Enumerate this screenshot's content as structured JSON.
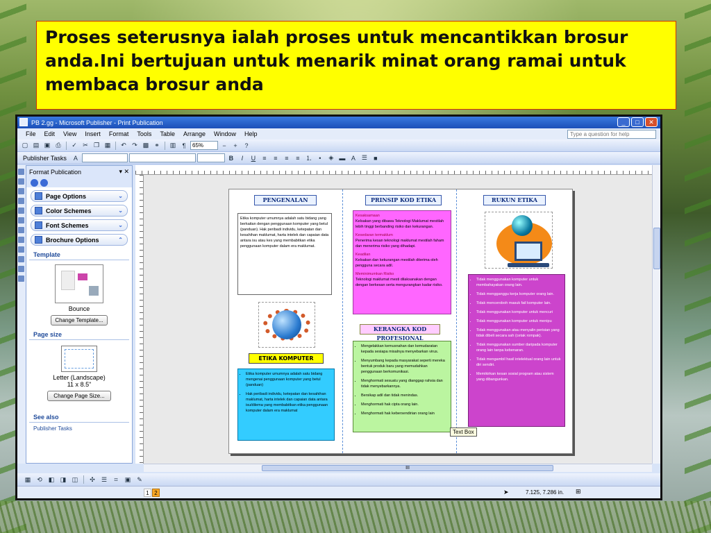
{
  "caption": {
    "text": "Proses seterusnya ialah proses untuk mencantikkan brosur anda.Ini bertujuan untuk menarik minat orang ramai untuk membaca brosur anda"
  },
  "window": {
    "title": "PB 2.gg - Microsoft Publisher - Print Publication",
    "buttons": {
      "minimize": "_",
      "maximize": "□",
      "close": "✕"
    }
  },
  "menu": {
    "items": [
      "File",
      "Edit",
      "View",
      "Insert",
      "Format",
      "Tools",
      "Table",
      "Arrange",
      "Window",
      "Help"
    ],
    "help_placeholder": "Type a question for help"
  },
  "toolbar": {
    "zoom": "65%",
    "publisher_tasks": "Publisher Tasks"
  },
  "taskpane": {
    "title": "Format Publication",
    "options": [
      "Page Options",
      "Color Schemes",
      "Font Schemes",
      "Brochure Options"
    ],
    "template_heading": "Template",
    "template_name": "Bounce",
    "change_template": "Change Template...",
    "page_size_heading": "Page size",
    "page_size_name": "Letter (Landscape)",
    "page_size_dims": "11 x 8.5\"",
    "change_page_size": "Change Page Size...",
    "see_also_heading": "See also",
    "see_also_link": "Publisher Tasks"
  },
  "brochure": {
    "panel1": {
      "title": "PENGENALAN",
      "intro": "Etika komputer umumnya adalah satu bidang yang berkaitan dengan penggunaan komputer yang betul (panduan). Hak peribadi individu, ketepatan dan kesahihan maklumat, harta intelek dan capaian data antara isu atau kes yang membabitkan etika penggunaan komputer dalam era maklumat.",
      "title2": "ETIKA KOMPUTER",
      "bullets": [
        "Etika komputer umumnya adalah satu bidang mengenai penggunaan komputer yang betul (panduan)",
        "Hak peribadi individu, ketepatan dan kesahihan maklumat, harta intelek dan capaian data antara isu/dilema yang membabitkan etika penggunaan komputer dalam era maklumat"
      ]
    },
    "panel2": {
      "title": "PRINSIP KOD ETIKA",
      "sections": [
        {
          "heading": "Kesaksamaan",
          "text": "Kelsakan yang dibawa Teknologi Maklumat mestilah lebih tinggi berbanding risiko dan kekurangan."
        },
        {
          "heading": "Kesedaran termaklum",
          "text": "Penerima kesan teknologi maklumat mestilah faham dan menerima risiko yang dihadapi."
        },
        {
          "heading": "Keadilan",
          "text": "Kelsakan dan kekurangan mestilah diterima oleh pengguna secara adil."
        },
        {
          "heading": "Meminimumkan Risiko",
          "text": "Teknologi maklumat mesti dilaksanakan dengan dengan berkesan serta mengurangkan kadar risiko."
        }
      ],
      "title2": "KERANGKA KOD PROFESIONAL",
      "bullets": [
        "Mengelakkan kemusnahan dan kemudaratan kepada sesiapa misalnya menyebarkan virus.",
        "Menyumbang kepada masyarakat seperti mereka bentuk produk baru yang memudahkan penggunaan berkomunikasi.",
        "Menghormati sesuatu yang dianggap rahsia dan tidak menyebarkannya.",
        "Bersikap adil dan tidak menindas.",
        "Menghormati hak cipta orang lain.",
        "Menghormati hak kebersendirian orang lain"
      ]
    },
    "panel3": {
      "title": "RUKUN ETIKA",
      "bullets": [
        "Tidak menggunakan komputer untuk membahayakan orang lain.",
        "Tidak mengganggu kerja komputer orang lain.",
        "Tidak menceroboh masuk fail komputer lain.",
        "Tidak menggunakan komputer untuk mencuri",
        "Tidak menggunakan komputer untuk menipu",
        "Tidak menggunakan atau menyalin perisian yang tidak dibeli secara sah (cetak rompak).",
        "Tidak menggunakan sumber daripada komputer orang lain tanpa kebenaran.",
        "Tidak mengambil hasil intelektual orang lain untuk diri sendiri.",
        "Memikirkan kesan sosial program atau sistem yang dibangunkan."
      ]
    },
    "tooltip": "Text Box"
  },
  "status": {
    "page1": "1",
    "page2": "2",
    "coords": "7.125, 7.286 in.",
    "hscroll_label": "III"
  },
  "colors": {
    "caption_bg": "#ffff00",
    "pink_box": "#ff66ff",
    "cyan_box": "#33ccff",
    "green_box": "#bbf5a0",
    "magenta_box": "#cc44cc",
    "yellow_title": "#ffff00"
  }
}
